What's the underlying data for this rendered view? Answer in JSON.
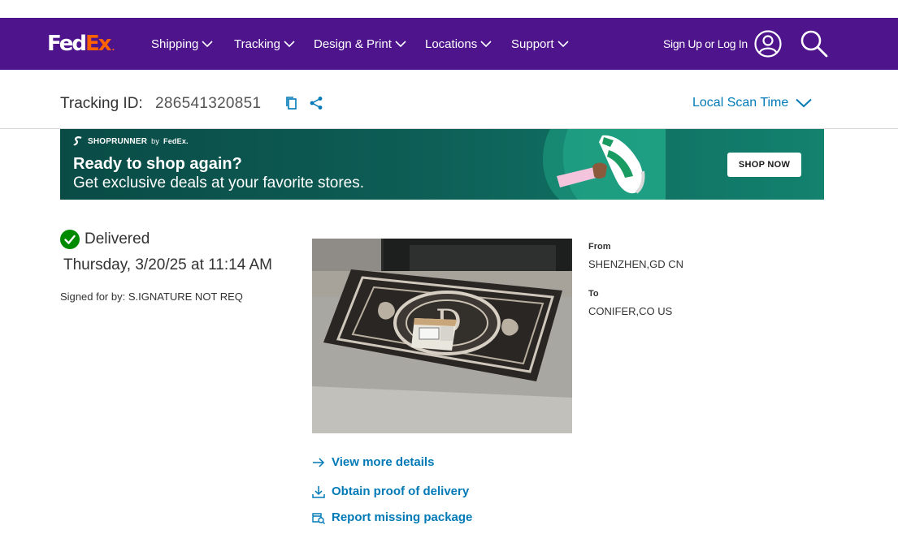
{
  "header": {
    "logo": {
      "fed": "Fed",
      "ex": "Ex",
      "mark": "."
    },
    "nav": [
      {
        "label": "Shipping"
      },
      {
        "label": "Tracking"
      },
      {
        "label": "Design & Print"
      },
      {
        "label": "Locations"
      },
      {
        "label": "Support"
      }
    ],
    "signin_label": "Sign Up or Log In",
    "icons": {
      "user": "user-circle-icon",
      "search": "search-icon"
    }
  },
  "tracking": {
    "label": "Tracking ID:",
    "id": "286541320851",
    "copy_icon": "copy-icon",
    "share_icon": "share-icon",
    "scan_time_label": "Local Scan Time"
  },
  "banner": {
    "brand": "SHOPRUNNER",
    "brand_by": "by",
    "brand_partner": "FedEx.",
    "headline": "Ready to shop again?",
    "subline": "Get exclusive deals at your favorite stores.",
    "cta": "SHOP NOW"
  },
  "shipment": {
    "status": "Delivered",
    "date": "Thursday, 3/20/25 at 11:14 AM",
    "signed_for": "Signed for by: S.IGNATURE NOT REQ",
    "from_label": "From",
    "from_value": "SHENZHEN,GD CN",
    "to_label": "To",
    "to_value": "CONIFER,CO US"
  },
  "actions": {
    "view_details": "View more details",
    "proof_of_delivery": "Obtain proof of delivery",
    "report_missing": "Report missing package"
  },
  "colors": {
    "brand_purple": "#4d148c",
    "brand_orange": "#ff6200",
    "link_blue": "#007ab7",
    "success_green": "#008a00",
    "banner_teal": "#0d5d55"
  }
}
